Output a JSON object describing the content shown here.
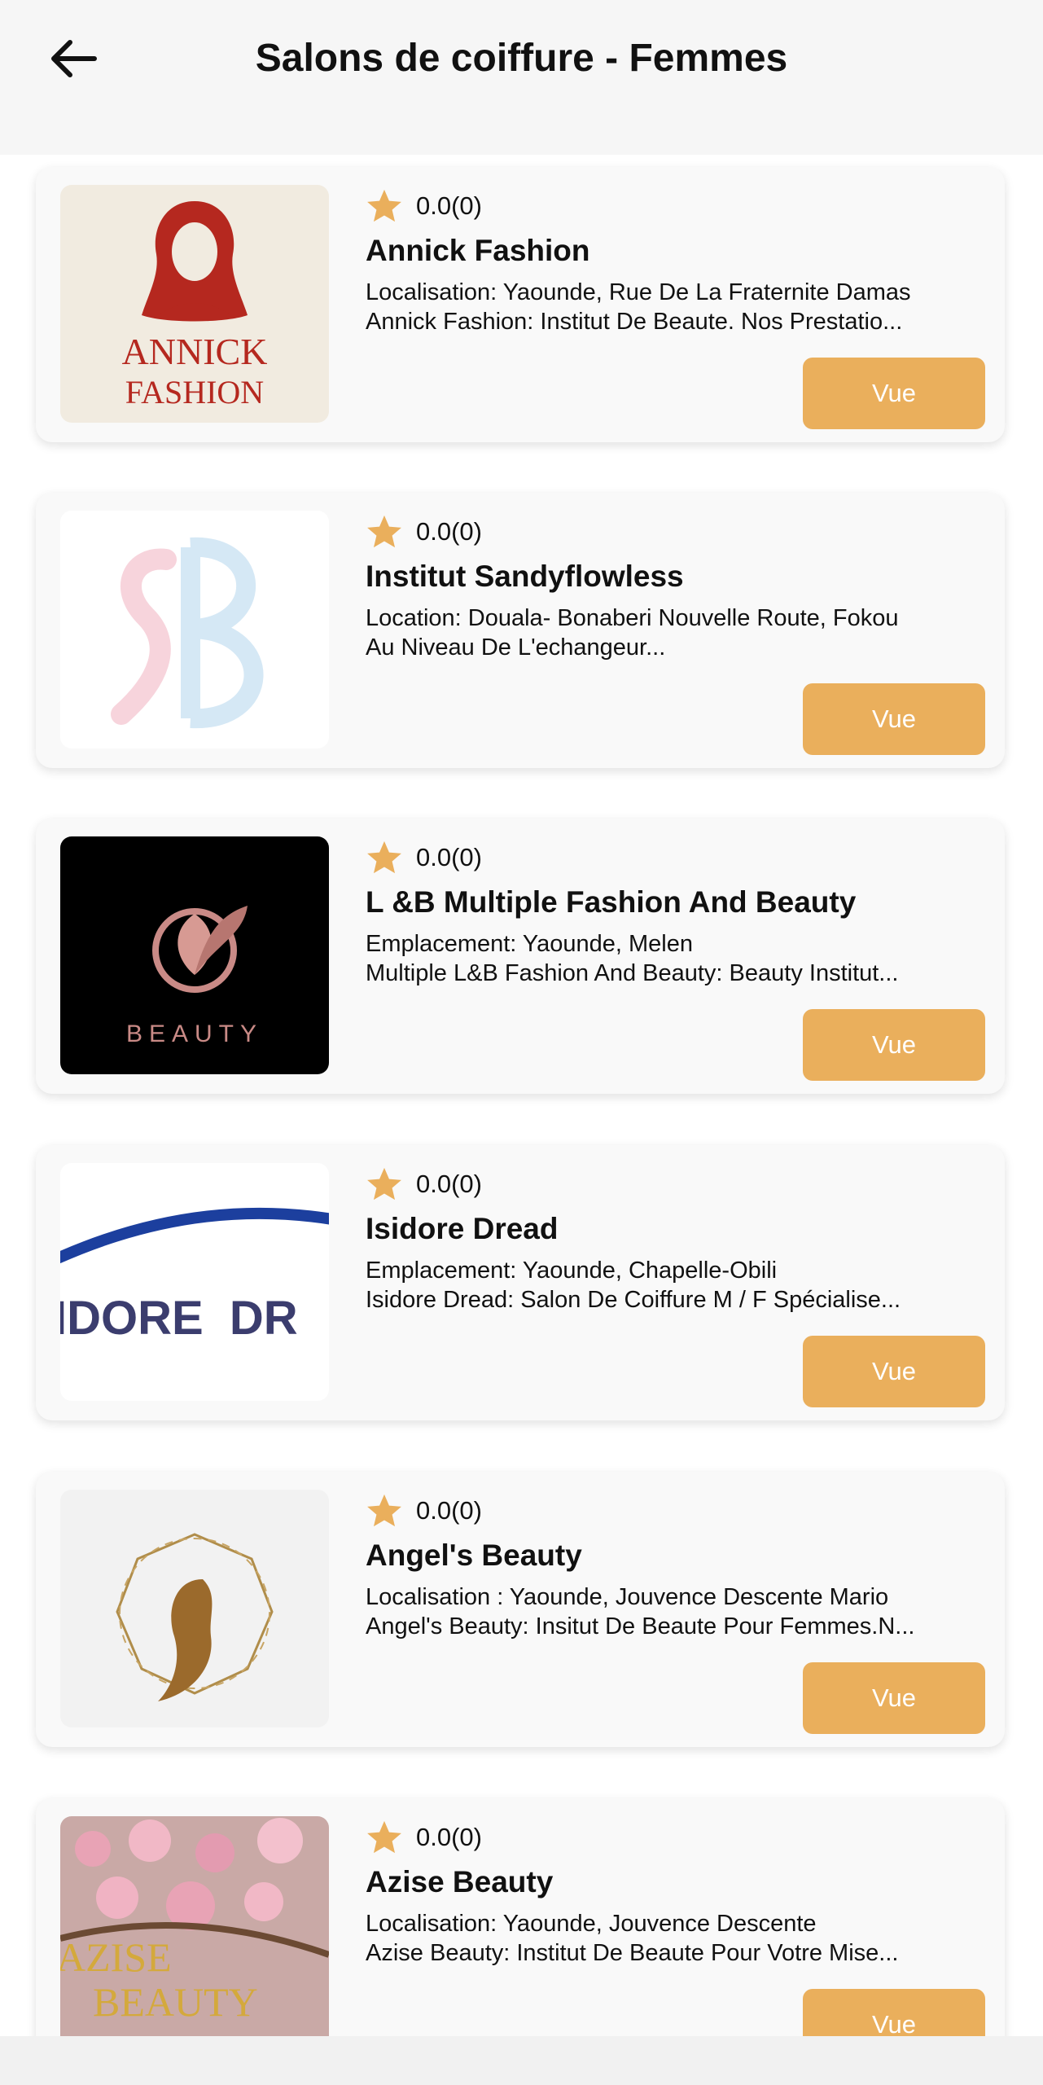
{
  "header": {
    "title": "Salons de coiffure - Femmes",
    "back_icon": "arrow-left-icon"
  },
  "colors": {
    "accent": "#EAAF5C",
    "star": "#EAAF5C"
  },
  "salons": [
    {
      "rating": "0.0(0)",
      "name": "Annick Fashion",
      "line1": "Localisation: Yaounde, Rue De La Fraternite Damas",
      "line2": "Annick Fashion: Institut De Beaute. Nos Prestatio...",
      "button": "Vue",
      "logo_text1": "ANNICK",
      "logo_text2": "FASHION"
    },
    {
      "rating": "0.0(0)",
      "name": "Institut Sandyflowless",
      "line1": "Location: Douala- Bonaberi Nouvelle Route, Fokou",
      "line2": "Au Niveau De L'echangeur...",
      "button": "Vue"
    },
    {
      "rating": "0.0(0)",
      "name": "L &B Multiple Fashion And Beauty",
      "line1": "Emplacement: Yaounde, Melen",
      "line2": "Multiple L&B Fashion And Beauty: Beauty Institut...",
      "button": "Vue",
      "logo_text1": "BEAUTY"
    },
    {
      "rating": "0.0(0)",
      "name": "Isidore Dread",
      "line1": "Emplacement: Yaounde, Chapelle-Obili",
      "line2": "Isidore Dread: Salon De Coiffure M / F Spécialise...",
      "button": "Vue",
      "logo_text1": "IDORE  DR"
    },
    {
      "rating": "0.0(0)",
      "name": "Angel's Beauty",
      "line1": "Localisation : Yaounde, Jouvence Descente Mario",
      "line2": "Angel's Beauty: Insitut De Beaute Pour Femmes.N...",
      "button": "Vue"
    },
    {
      "rating": "0.0(0)",
      "name": "Azise Beauty",
      "line1": "Localisation: Yaounde, Jouvence Descente",
      "line2": "Azise Beauty: Institut De Beaute Pour Votre Mise...",
      "button": "Vue",
      "logo_text1": "AZISE",
      "logo_text2": "BEAUTY"
    }
  ]
}
